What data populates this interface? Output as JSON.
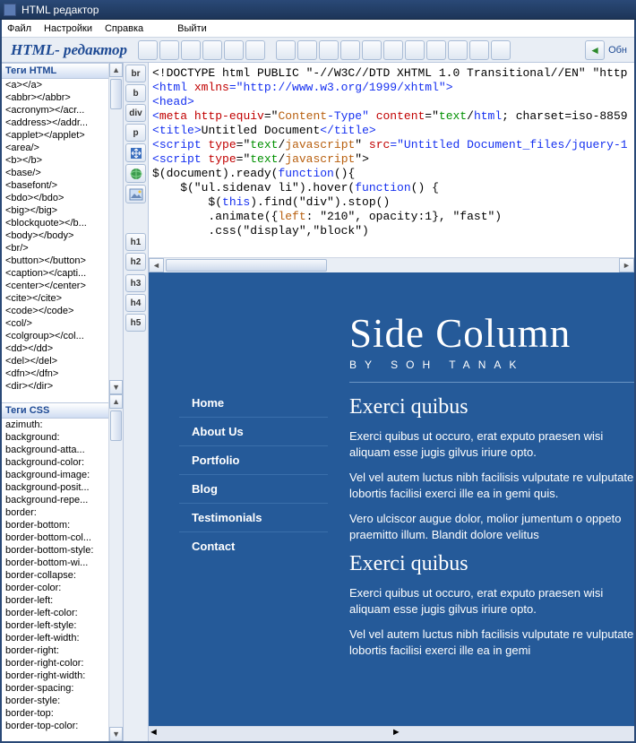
{
  "window": {
    "title": "HTML редактор"
  },
  "menu": {
    "file": "Файл",
    "settings": "Настройки",
    "help": "Справка",
    "exit": "Выйти"
  },
  "app_title": "HTML- редактор",
  "toolbar": {
    "refresh": "Обн"
  },
  "panels": {
    "html_tags": "Теги HTML",
    "css_tags": "Теги CSS"
  },
  "html_tags": [
    "<a></a>",
    "<abbr></abbr>",
    "<acronym></acr...",
    "<address></addr...",
    "<applet></applet>",
    "<area/>",
    "<b></b>",
    "<base/>",
    "<basefont/>",
    "<bdo></bdo>",
    "<big></big>",
    "<blockquote></b...",
    "<body></body>",
    "<br/>",
    "<button></button>",
    "<caption></capti...",
    "<center></center>",
    "<cite></cite>",
    "<code></code>",
    "<col/>",
    "<colgroup></col...",
    "<dd></dd>",
    "<del></del>",
    "<dfn></dfn>",
    "<dir></dir>"
  ],
  "css_tags": [
    "azimuth:",
    "background:",
    "background-atta...",
    "background-color:",
    "background-image:",
    "background-posit...",
    "background-repe...",
    "border:",
    "border-bottom:",
    "border-bottom-col...",
    "border-bottom-style:",
    "border-bottom-wi...",
    "border-collapse:",
    "border-color:",
    "border-left:",
    "border-left-color:",
    "border-left-style:",
    "border-left-width:",
    "border-right:",
    "border-right-color:",
    "border-right-width:",
    "border-spacing:",
    "border-style:",
    "border-top:",
    "border-top-color:"
  ],
  "insert_buttons": {
    "br": "br",
    "b": "b",
    "div": "div",
    "p": "p"
  },
  "heading_buttons": [
    "h1",
    "h2",
    "h3",
    "h4",
    "h5"
  ],
  "code_lines": [
    {
      "raw": [
        {
          "t": "<!DOCTYPE html PUBLIC \"-//W3C//DTD XHTML 1.0 Transitional//EN\" \"http",
          "c": "tok-c"
        }
      ]
    },
    {
      "raw": [
        {
          "t": "<",
          "c": "tok-tag"
        },
        {
          "t": "html",
          "c": "tok-tag"
        },
        {
          "t": " xmlns",
          "c": "tok-attr"
        },
        {
          "t": "=\"http://www.w3.org/1999/xhtml\"",
          "c": "tok-val"
        },
        {
          "t": ">",
          "c": "tok-tag"
        }
      ]
    },
    {
      "raw": [
        {
          "t": "<",
          "c": "tok-tag"
        },
        {
          "t": "head",
          "c": "tok-tag"
        },
        {
          "t": ">",
          "c": "tok-tag"
        }
      ]
    },
    {
      "raw": [
        {
          "t": "<",
          "c": "tok-tag"
        },
        {
          "t": "meta",
          "c": "tok-red"
        },
        {
          "t": " http-equiv",
          "c": "tok-attr"
        },
        {
          "t": "=\"",
          "c": "tok-c"
        },
        {
          "t": "Content",
          "c": "tok-br"
        },
        {
          "t": "-Type\" ",
          "c": "tok-val"
        },
        {
          "t": "content",
          "c": "tok-attr"
        },
        {
          "t": "=\"",
          "c": "tok-c"
        },
        {
          "t": "text",
          "c": "tok-green"
        },
        {
          "t": "/",
          "c": "tok-c"
        },
        {
          "t": "html",
          "c": "tok-tag"
        },
        {
          "t": "; charset=iso-8859",
          "c": "tok-c"
        }
      ]
    },
    {
      "raw": [
        {
          "t": "<",
          "c": "tok-tag"
        },
        {
          "t": "title",
          "c": "tok-tag"
        },
        {
          "t": ">",
          "c": "tok-tag"
        },
        {
          "t": "Untitled Document",
          "c": "tok-c"
        },
        {
          "t": "</",
          "c": "tok-tag"
        },
        {
          "t": "title",
          "c": "tok-tag"
        },
        {
          "t": ">",
          "c": "tok-tag"
        }
      ]
    },
    {
      "raw": [
        {
          "t": "<",
          "c": "tok-tag"
        },
        {
          "t": "script",
          "c": "tok-tag"
        },
        {
          "t": " type",
          "c": "tok-attr"
        },
        {
          "t": "=\"",
          "c": "tok-c"
        },
        {
          "t": "text",
          "c": "tok-green"
        },
        {
          "t": "/",
          "c": "tok-c"
        },
        {
          "t": "javascript",
          "c": "tok-br"
        },
        {
          "t": "\" ",
          "c": "tok-c"
        },
        {
          "t": "src",
          "c": "tok-attr"
        },
        {
          "t": "=\"Untitled Document_files/jquery-1",
          "c": "tok-val"
        }
      ]
    },
    {
      "raw": [
        {
          "t": "<",
          "c": "tok-tag"
        },
        {
          "t": "script",
          "c": "tok-tag"
        },
        {
          "t": " type",
          "c": "tok-attr"
        },
        {
          "t": "=\"",
          "c": "tok-c"
        },
        {
          "t": "text",
          "c": "tok-green"
        },
        {
          "t": "/",
          "c": "tok-c"
        },
        {
          "t": "javascript",
          "c": "tok-br"
        },
        {
          "t": "\">",
          "c": "tok-c"
        }
      ]
    },
    {
      "raw": [
        {
          "t": "",
          "c": "tok-c"
        }
      ]
    },
    {
      "raw": [
        {
          "t": "$(document).ready(",
          "c": "tok-c"
        },
        {
          "t": "function",
          "c": "tok-tag"
        },
        {
          "t": "(){",
          "c": "tok-c"
        }
      ]
    },
    {
      "raw": [
        {
          "t": "",
          "c": "tok-c"
        }
      ]
    },
    {
      "raw": [
        {
          "t": "    $(\"ul.sidenav li\").hover(",
          "c": "tok-c"
        },
        {
          "t": "function",
          "c": "tok-tag"
        },
        {
          "t": "() {",
          "c": "tok-c"
        }
      ]
    },
    {
      "raw": [
        {
          "t": "        $(",
          "c": "tok-c"
        },
        {
          "t": "this",
          "c": "tok-tag"
        },
        {
          "t": ").find(\"div\").stop()",
          "c": "tok-c"
        }
      ]
    },
    {
      "raw": [
        {
          "t": "        .animate({",
          "c": "tok-c"
        },
        {
          "t": "left",
          "c": "tok-br"
        },
        {
          "t": ": \"210\", opacity:1}, \"fast\")",
          "c": "tok-c"
        }
      ]
    },
    {
      "raw": [
        {
          "t": "        .css(\"display\",\"block\")",
          "c": "tok-c"
        }
      ]
    }
  ],
  "preview": {
    "title_big": "Side Column",
    "byline": "BY SOH TANAK",
    "nav": [
      "Home",
      "About Us",
      "Portfolio",
      "Blog",
      "Testimonials",
      "Contact"
    ],
    "s1_head": "Exerci quibus",
    "p1": "Exerci quibus ut occuro, erat exputo praesen wisi aliquam esse jugis gilvus iriure opto.",
    "p2": "Vel vel autem luctus nibh facilisis vulputate re vulputate lobortis facilisi exerci ille ea in gemi quis.",
    "p3": "Vero ulciscor augue dolor, molior jumentum o oppeto praemitto illum. Blandit dolore velitus",
    "s2_head": "Exerci quibus",
    "p4": "Exerci quibus ut occuro, erat exputo praesen wisi aliquam esse jugis gilvus iriure opto.",
    "p5": "Vel vel autem luctus nibh facilisis vulputate re vulputate lobortis facilisi exerci ille ea in gemi"
  }
}
